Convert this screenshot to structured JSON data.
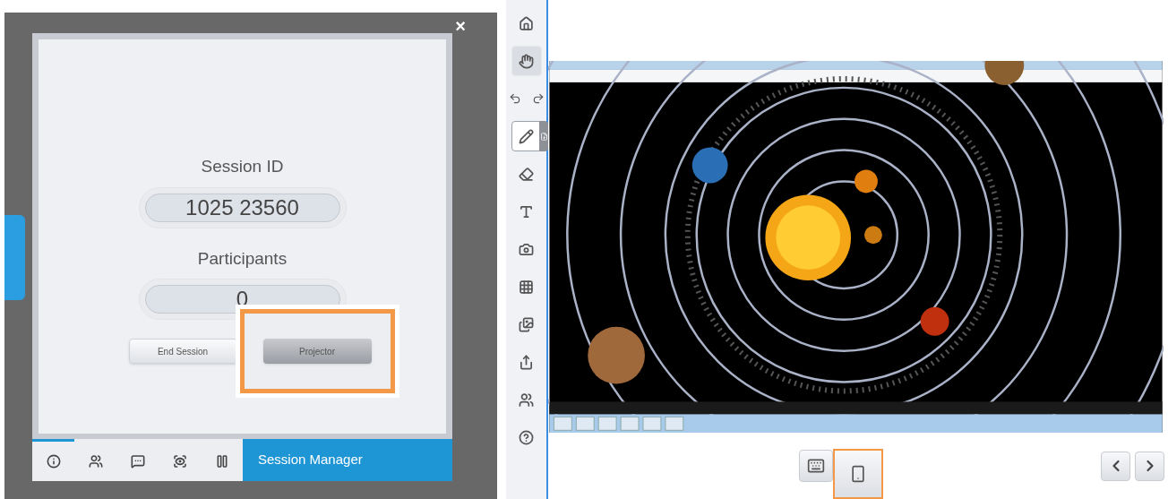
{
  "dialog": {
    "close_label": "×",
    "title": "Session Manager",
    "session_id": {
      "label": "Session ID",
      "value": "1025 23560"
    },
    "participants": {
      "label": "Participants",
      "value": "0"
    },
    "buttons": [
      {
        "label": "End Session",
        "highlighted": false
      },
      {
        "label": "Projector",
        "highlighted": true
      }
    ],
    "tabs": [
      {
        "kind": "info",
        "selected": true
      },
      {
        "kind": "users",
        "selected": false
      },
      {
        "kind": "chat",
        "selected": false
      },
      {
        "kind": "view",
        "selected": false
      },
      {
        "kind": "pause",
        "selected": false
      }
    ]
  },
  "toolbar": {
    "tools": [
      {
        "kind": "home",
        "selected": false
      },
      {
        "kind": "hand",
        "selected": true
      },
      {
        "kind": "undo-redo",
        "selected": false
      },
      {
        "kind": "pen",
        "selected": false
      },
      {
        "kind": "eraser",
        "selected": false
      },
      {
        "kind": "text",
        "selected": false
      },
      {
        "kind": "camera",
        "selected": false
      },
      {
        "kind": "grid",
        "selected": false
      },
      {
        "kind": "images",
        "selected": false
      },
      {
        "kind": "share",
        "selected": false
      },
      {
        "kind": "users",
        "selected": false
      },
      {
        "kind": "help",
        "selected": false
      }
    ]
  },
  "bottom_buttons": [
    {
      "kind": "keyboard",
      "highlighted": false
    },
    {
      "kind": "projector",
      "highlighted": true
    }
  ],
  "nav": [
    {
      "kind": "prev"
    },
    {
      "kind": "next"
    }
  ]
}
